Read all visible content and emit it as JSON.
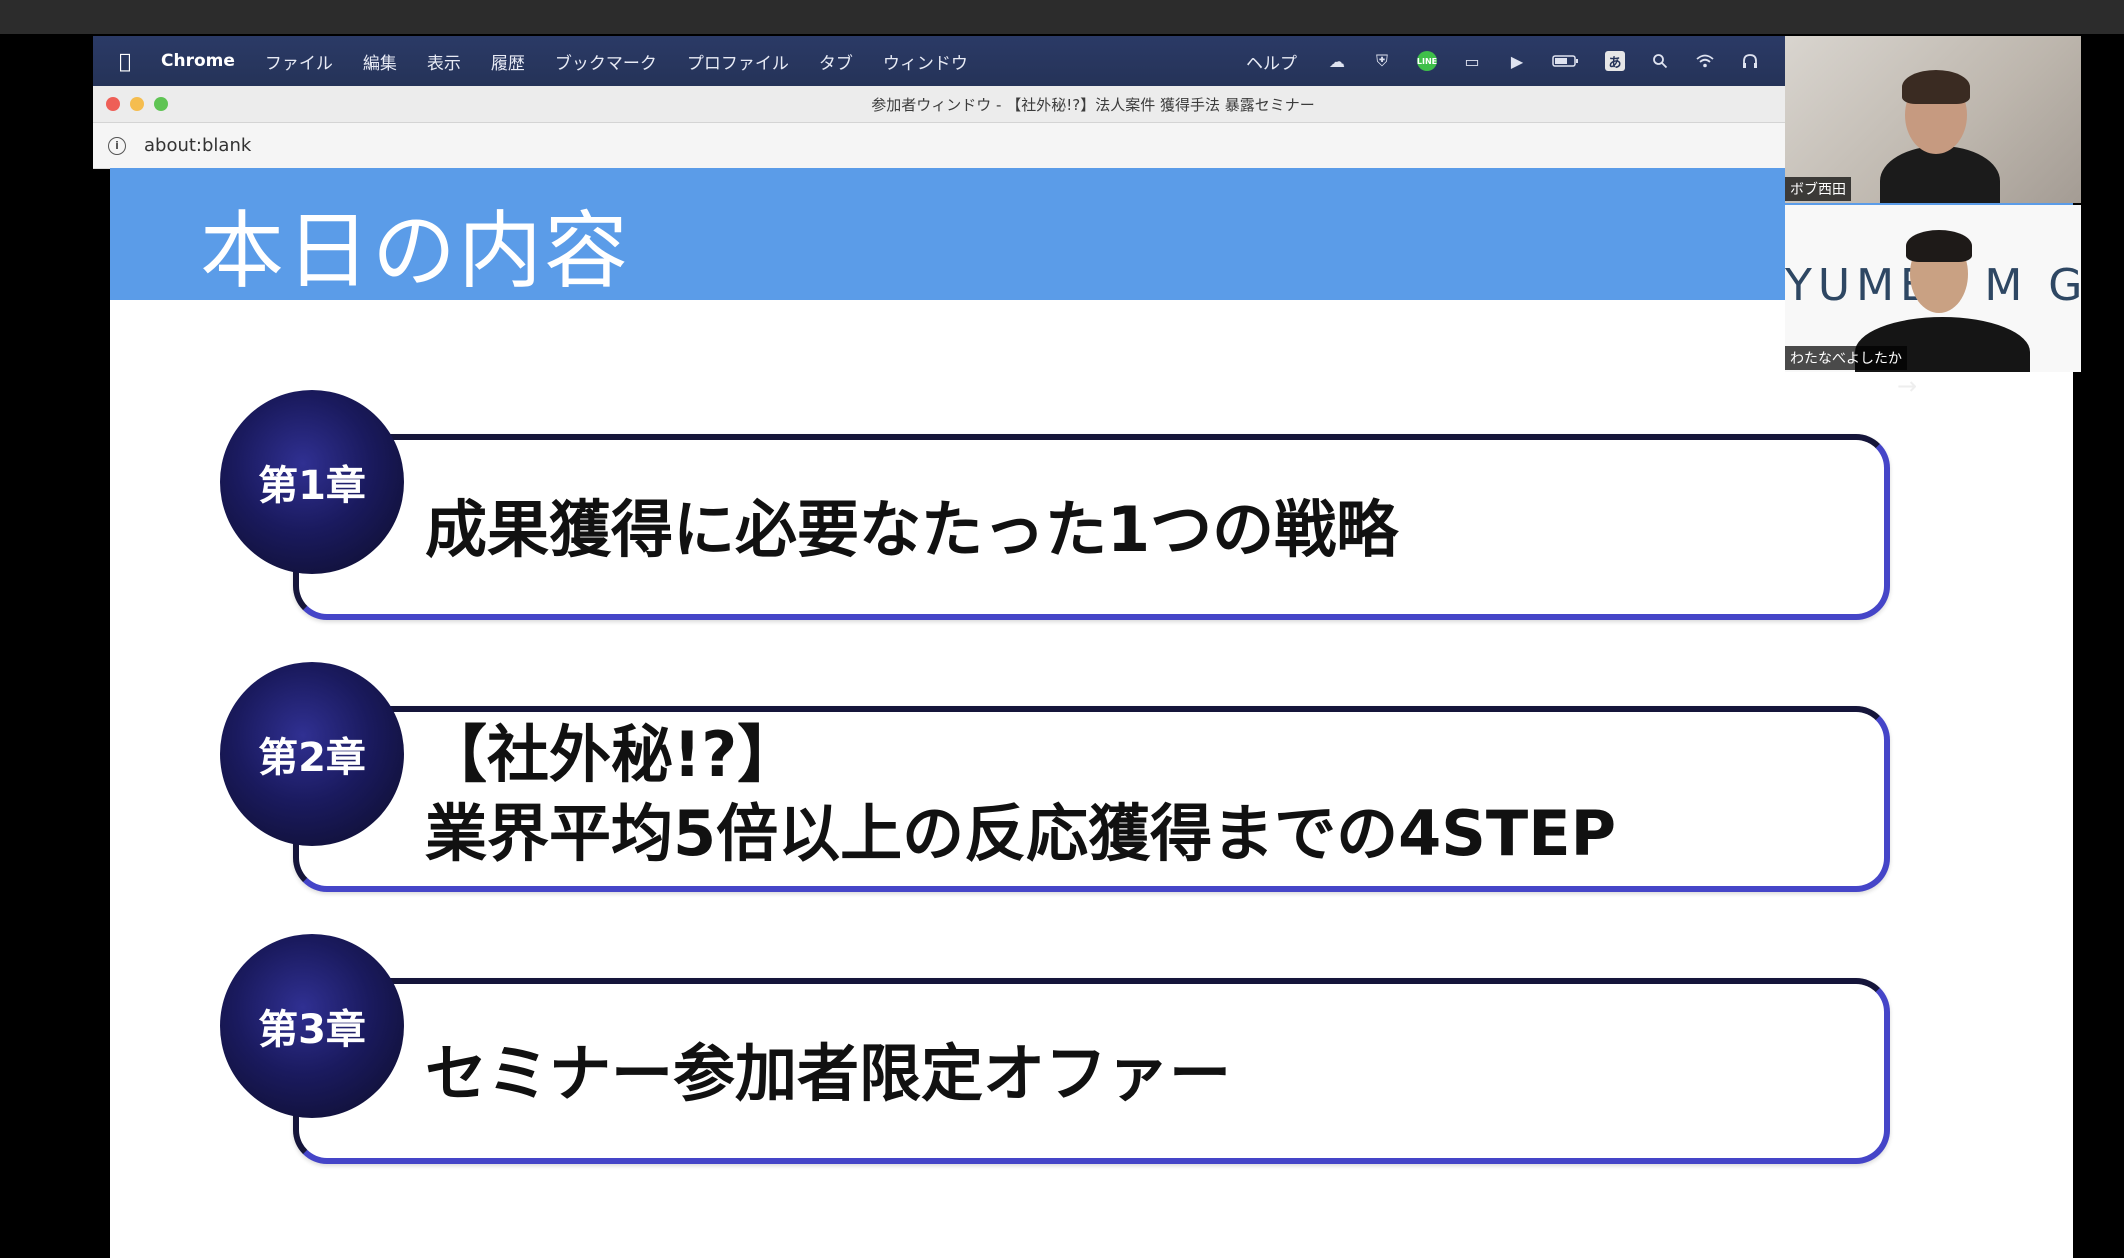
{
  "menubar": {
    "app": "Chrome",
    "items": [
      "ファイル",
      "編集",
      "表示",
      "履歴",
      "ブックマーク",
      "プロファイル",
      "タブ",
      "ウィンドウ"
    ],
    "help": "ヘルプ",
    "tray_icons": [
      "cloud-sync-icon",
      "shield-icon",
      "line-icon",
      "display-icon",
      "play-icon",
      "battery-icon",
      "input-method-icon",
      "search-icon",
      "wifi-icon",
      "headphones-icon"
    ],
    "line_label": "LINE",
    "kana_label": "あ"
  },
  "browser": {
    "window_title": "参加者ウィンドウ - 【社外秘!?】法人案件 獲得手法 暴露セミナー",
    "url": "about:blank"
  },
  "slide": {
    "title": "本日の内容",
    "chapters": [
      {
        "badge": "第1章",
        "line1": "成果獲得に必要なたった1つの戦略",
        "line2": ""
      },
      {
        "badge": "第2章",
        "line1": "【社外秘!?】",
        "line2": "業界平均5倍以上の反応獲得までの4STEP"
      },
      {
        "badge": "第3章",
        "line1": "セミナー参加者限定オファー",
        "line2": ""
      }
    ]
  },
  "participants": [
    {
      "name": "ボブ西田"
    },
    {
      "name": "わたなべよしたか",
      "background_text": "YUMEL   M GR"
    }
  ],
  "colors": {
    "header_blue": "#5b9ce8",
    "badge_navy": "#1a1a5e",
    "border_indigo": "#4545c8",
    "menubar": "#253358"
  }
}
